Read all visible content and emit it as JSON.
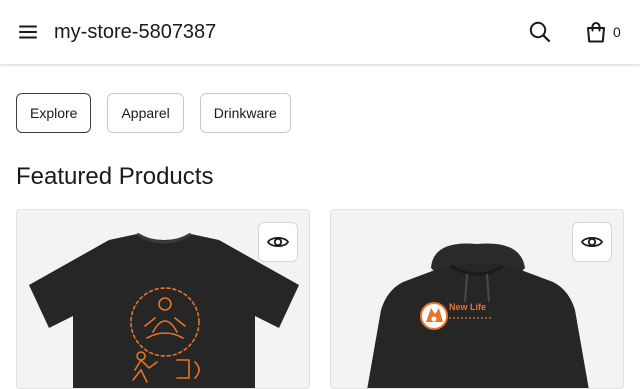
{
  "header": {
    "store_name": "my-store-5807387",
    "cart_count": "0",
    "icons": [
      "menu-icon",
      "search-icon",
      "shopping-bag-icon"
    ]
  },
  "categories": [
    {
      "label": "Explore",
      "active": true
    },
    {
      "label": "Apparel",
      "active": false
    },
    {
      "label": "Drinkware",
      "active": false
    }
  ],
  "featured": {
    "title": "Featured Products",
    "products": [
      {
        "image": "black t-shirt with orange meditation graphic",
        "quick_view_icon": "eye-icon"
      },
      {
        "image": "black hoodie with orange New Life fox logo",
        "logo_text": "New Life",
        "quick_view_icon": "eye-icon"
      }
    ]
  },
  "colors": {
    "accent_border": "#3a3f4b",
    "graphic_orange": "#e8742a"
  }
}
